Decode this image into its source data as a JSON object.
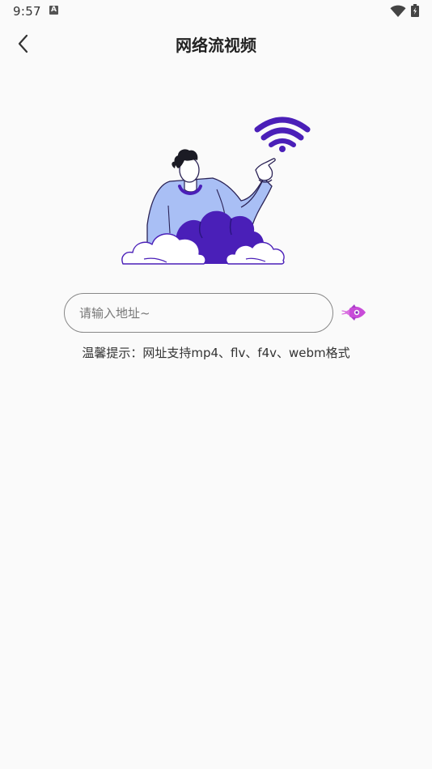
{
  "status_bar": {
    "time": "9:57",
    "notification_icon": "a-icon",
    "icons": [
      "wifi-icon",
      "battery-icon"
    ]
  },
  "app_bar": {
    "title": "网络流视频",
    "back_icon": "chevron-left-icon"
  },
  "illustration": {
    "icon": "person-pointing-wifi-illustration",
    "colors": {
      "primary": "#4a1fb8",
      "shirt": "#a9bff5",
      "outline": "#2b2356"
    }
  },
  "input": {
    "value": "",
    "placeholder": "请输入地址~"
  },
  "go_button": {
    "icon": "rocket-icon",
    "color": "#c84bd8"
  },
  "tip": "温馨提示：网址支持mp4、flv、f4v、webm格式"
}
